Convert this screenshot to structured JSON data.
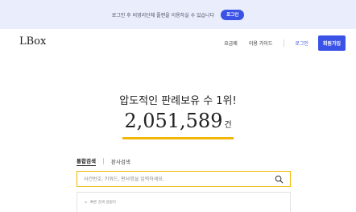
{
  "banner": {
    "text": "로그인 후 비영리단체 플랜을 이용하실 수 있습니다",
    "button_label": "로그인"
  },
  "header": {
    "logo": "LBox",
    "nav": {
      "pricing": "요금제",
      "guide": "이용 가이드",
      "login": "로그인",
      "signup": "회원가입"
    }
  },
  "hero": {
    "title": "압도적인 판례보유 수 1위!",
    "count": "2,051,589",
    "count_unit": "건"
  },
  "search": {
    "tabs": [
      "통합검색",
      "판사검색"
    ],
    "active_tab": "통합검색",
    "placeholder": "사건번호, 키워드, 판사명을 입력하세요.",
    "value": ""
  },
  "quick_guide": {
    "label": "빠른 검색 방법이",
    "icon": "sparkle-icon"
  },
  "colors": {
    "accent": "#3a52e6",
    "banner_bg": "#eaedfc",
    "highlight": "#f2b705"
  }
}
